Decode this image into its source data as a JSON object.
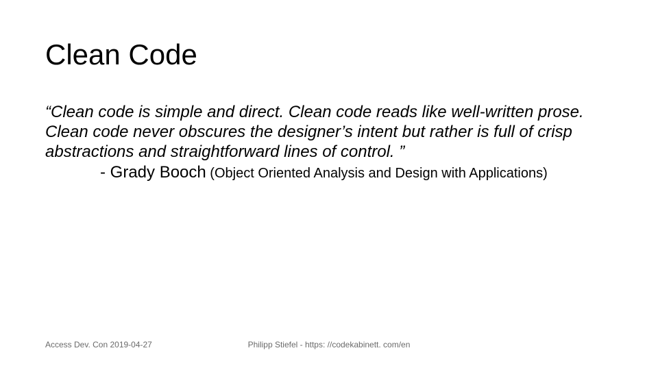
{
  "title": "Clean Code",
  "quote": "“Clean code is simple and direct. Clean code reads like well-written prose. Clean code never obscures the designer’s intent but rather is full of crisp abstractions and straightforward lines of control. ”",
  "attribution": {
    "prefix": "- ",
    "name": "Grady Booch",
    "source": " (Object Oriented Analysis and Design with Applications)"
  },
  "footer": {
    "left": "Access Dev. Con 2019-04-27",
    "center": "Philipp Stiefel - https: //codekabinett. com/en"
  }
}
